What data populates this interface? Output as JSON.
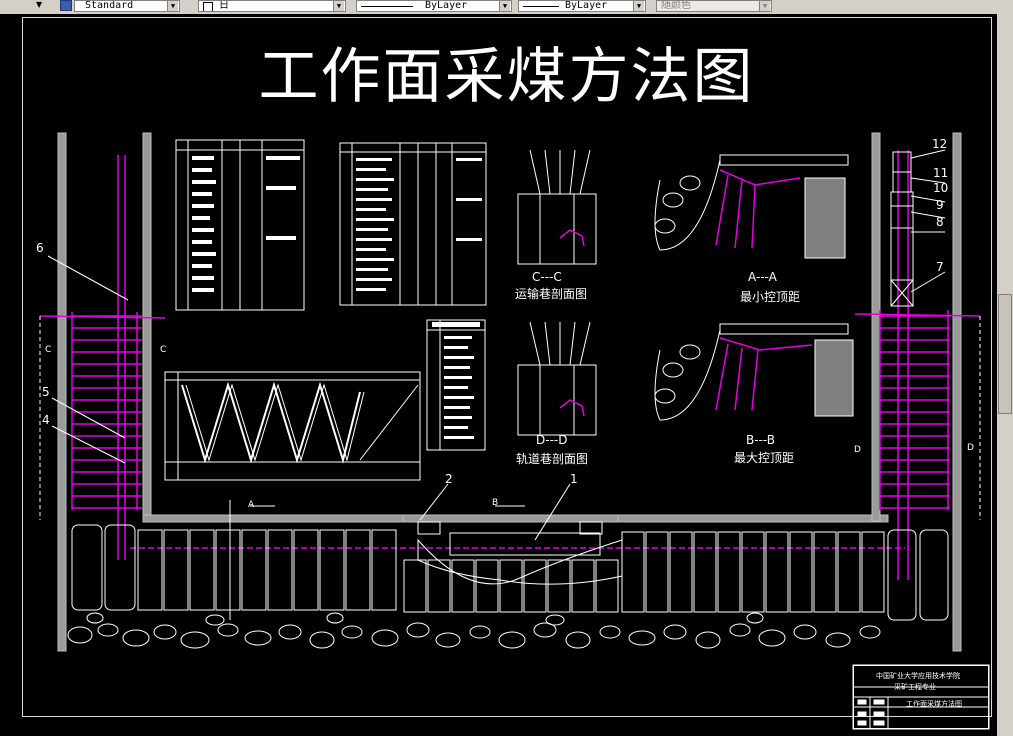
{
  "toolbar": {
    "textstyle": "Standard",
    "dimstyle": "日",
    "linetype": "ByLayer",
    "lineweight": "ByLayer",
    "plotstyle": "随颜色"
  },
  "drawing": {
    "title": "工作面采煤方法图",
    "sections": {
      "transport_section": "C---C",
      "transport_caption": "运输巷剖面图",
      "track_section": "D---D",
      "track_caption": "轨道巷剖面图",
      "min_section": "A---A",
      "min_caption": "最小控顶距",
      "max_section": "B---B",
      "max_caption": "最大控顶距"
    },
    "markers": {
      "c_left_a": "C",
      "c_left_b": "C",
      "d_right_a": "D",
      "d_right_b": "D",
      "arrow_a": "A",
      "arrow_b": "B"
    },
    "callouts": [
      "1",
      "2",
      "4",
      "5",
      "6",
      "7",
      "8",
      "9",
      "10",
      "11",
      "12"
    ],
    "title_block": {
      "school": "中国矿业大学应用技术学院",
      "major": "采矿工程专业",
      "drawing_name": "工作面采煤方法图"
    }
  }
}
